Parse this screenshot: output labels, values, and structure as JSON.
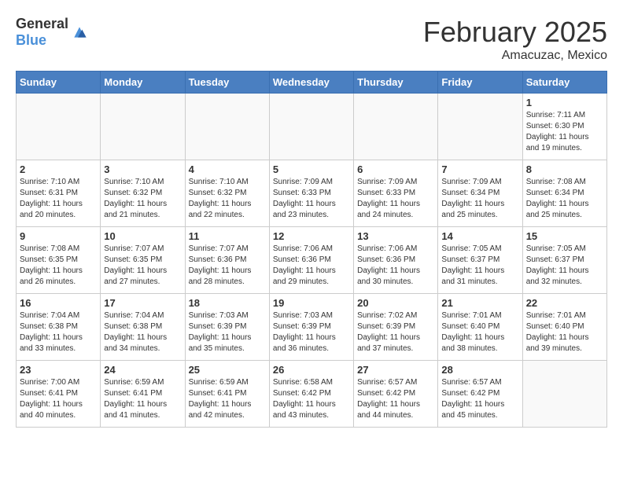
{
  "header": {
    "logo_general": "General",
    "logo_blue": "Blue",
    "month_title": "February 2025",
    "location": "Amacuzac, Mexico"
  },
  "weekdays": [
    "Sunday",
    "Monday",
    "Tuesday",
    "Wednesday",
    "Thursday",
    "Friday",
    "Saturday"
  ],
  "weeks": [
    [
      {
        "day": "",
        "info": ""
      },
      {
        "day": "",
        "info": ""
      },
      {
        "day": "",
        "info": ""
      },
      {
        "day": "",
        "info": ""
      },
      {
        "day": "",
        "info": ""
      },
      {
        "day": "",
        "info": ""
      },
      {
        "day": "1",
        "info": "Sunrise: 7:11 AM\nSunset: 6:30 PM\nDaylight: 11 hours\nand 19 minutes."
      }
    ],
    [
      {
        "day": "2",
        "info": "Sunrise: 7:10 AM\nSunset: 6:31 PM\nDaylight: 11 hours\nand 20 minutes."
      },
      {
        "day": "3",
        "info": "Sunrise: 7:10 AM\nSunset: 6:32 PM\nDaylight: 11 hours\nand 21 minutes."
      },
      {
        "day": "4",
        "info": "Sunrise: 7:10 AM\nSunset: 6:32 PM\nDaylight: 11 hours\nand 22 minutes."
      },
      {
        "day": "5",
        "info": "Sunrise: 7:09 AM\nSunset: 6:33 PM\nDaylight: 11 hours\nand 23 minutes."
      },
      {
        "day": "6",
        "info": "Sunrise: 7:09 AM\nSunset: 6:33 PM\nDaylight: 11 hours\nand 24 minutes."
      },
      {
        "day": "7",
        "info": "Sunrise: 7:09 AM\nSunset: 6:34 PM\nDaylight: 11 hours\nand 25 minutes."
      },
      {
        "day": "8",
        "info": "Sunrise: 7:08 AM\nSunset: 6:34 PM\nDaylight: 11 hours\nand 25 minutes."
      }
    ],
    [
      {
        "day": "9",
        "info": "Sunrise: 7:08 AM\nSunset: 6:35 PM\nDaylight: 11 hours\nand 26 minutes."
      },
      {
        "day": "10",
        "info": "Sunrise: 7:07 AM\nSunset: 6:35 PM\nDaylight: 11 hours\nand 27 minutes."
      },
      {
        "day": "11",
        "info": "Sunrise: 7:07 AM\nSunset: 6:36 PM\nDaylight: 11 hours\nand 28 minutes."
      },
      {
        "day": "12",
        "info": "Sunrise: 7:06 AM\nSunset: 6:36 PM\nDaylight: 11 hours\nand 29 minutes."
      },
      {
        "day": "13",
        "info": "Sunrise: 7:06 AM\nSunset: 6:36 PM\nDaylight: 11 hours\nand 30 minutes."
      },
      {
        "day": "14",
        "info": "Sunrise: 7:05 AM\nSunset: 6:37 PM\nDaylight: 11 hours\nand 31 minutes."
      },
      {
        "day": "15",
        "info": "Sunrise: 7:05 AM\nSunset: 6:37 PM\nDaylight: 11 hours\nand 32 minutes."
      }
    ],
    [
      {
        "day": "16",
        "info": "Sunrise: 7:04 AM\nSunset: 6:38 PM\nDaylight: 11 hours\nand 33 minutes."
      },
      {
        "day": "17",
        "info": "Sunrise: 7:04 AM\nSunset: 6:38 PM\nDaylight: 11 hours\nand 34 minutes."
      },
      {
        "day": "18",
        "info": "Sunrise: 7:03 AM\nSunset: 6:39 PM\nDaylight: 11 hours\nand 35 minutes."
      },
      {
        "day": "19",
        "info": "Sunrise: 7:03 AM\nSunset: 6:39 PM\nDaylight: 11 hours\nand 36 minutes."
      },
      {
        "day": "20",
        "info": "Sunrise: 7:02 AM\nSunset: 6:39 PM\nDaylight: 11 hours\nand 37 minutes."
      },
      {
        "day": "21",
        "info": "Sunrise: 7:01 AM\nSunset: 6:40 PM\nDaylight: 11 hours\nand 38 minutes."
      },
      {
        "day": "22",
        "info": "Sunrise: 7:01 AM\nSunset: 6:40 PM\nDaylight: 11 hours\nand 39 minutes."
      }
    ],
    [
      {
        "day": "23",
        "info": "Sunrise: 7:00 AM\nSunset: 6:41 PM\nDaylight: 11 hours\nand 40 minutes."
      },
      {
        "day": "24",
        "info": "Sunrise: 6:59 AM\nSunset: 6:41 PM\nDaylight: 11 hours\nand 41 minutes."
      },
      {
        "day": "25",
        "info": "Sunrise: 6:59 AM\nSunset: 6:41 PM\nDaylight: 11 hours\nand 42 minutes."
      },
      {
        "day": "26",
        "info": "Sunrise: 6:58 AM\nSunset: 6:42 PM\nDaylight: 11 hours\nand 43 minutes."
      },
      {
        "day": "27",
        "info": "Sunrise: 6:57 AM\nSunset: 6:42 PM\nDaylight: 11 hours\nand 44 minutes."
      },
      {
        "day": "28",
        "info": "Sunrise: 6:57 AM\nSunset: 6:42 PM\nDaylight: 11 hours\nand 45 minutes."
      },
      {
        "day": "",
        "info": ""
      }
    ]
  ]
}
